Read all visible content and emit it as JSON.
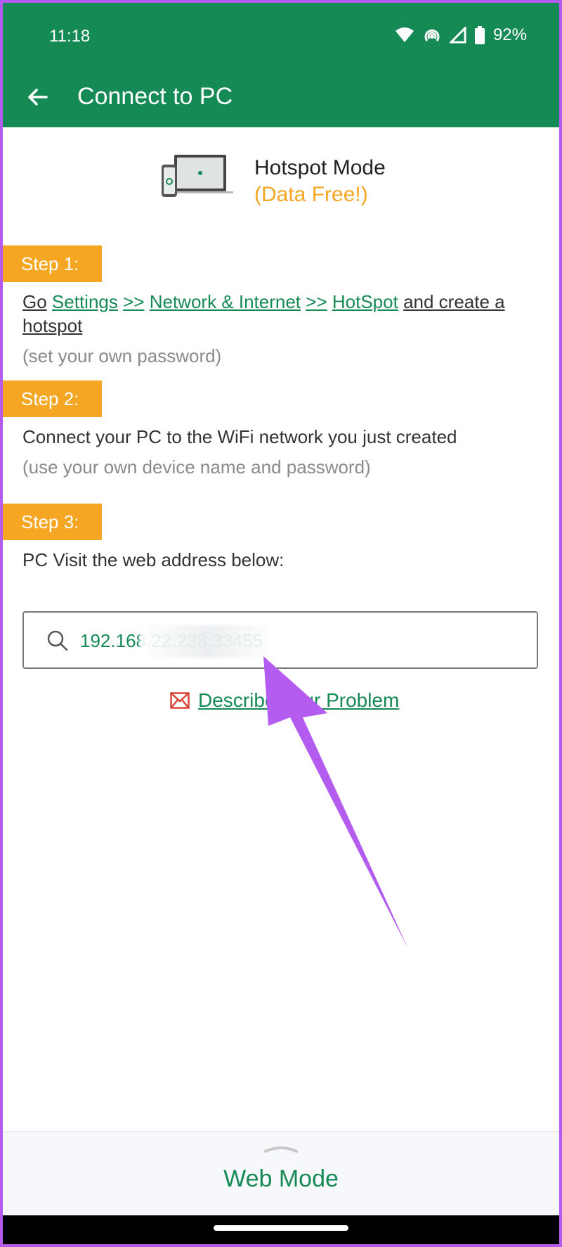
{
  "status": {
    "time": "11:18",
    "battery": "92%"
  },
  "appbar": {
    "title": "Connect to PC"
  },
  "hero": {
    "title": "Hotspot Mode",
    "subtitle": "(Data Free!)"
  },
  "step1": {
    "badge": "Step 1:",
    "go": "Go",
    "settings": "Settings",
    "sep1": ">>",
    "network": "Network & Internet",
    "sep2": ">>",
    "hotspot": "HotSpot",
    "tail1": "and create a",
    "tail2": "hotspot",
    "note": "(set your own password)"
  },
  "step2": {
    "badge": "Step 2:",
    "text": "Connect your PC to the WiFi network you just created",
    "note": "(use your own device name and password)"
  },
  "step3": {
    "badge": "Step 3:",
    "text": "PC Visit the web address below:"
  },
  "search": {
    "value": "192.168.22.238:33455"
  },
  "describe": {
    "label": "Describe Your Problem"
  },
  "bottom": {
    "label": "Web Mode"
  },
  "colors": {
    "green": "#168a55",
    "orange": "#f5a623",
    "annotation": "#b45cf0"
  }
}
